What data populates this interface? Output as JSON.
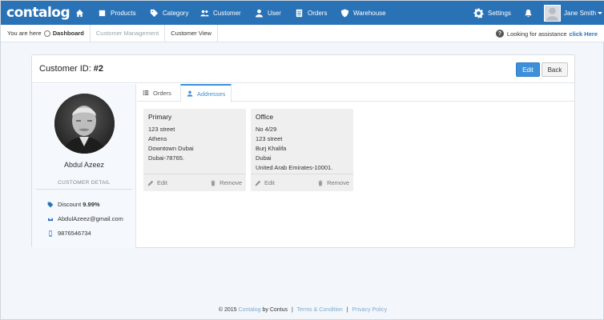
{
  "app": {
    "logo": "contalog"
  },
  "nav": {
    "items": [
      {
        "label": "",
        "icon": "home-icon"
      },
      {
        "label": "Products",
        "icon": "products-icon"
      },
      {
        "label": "Category",
        "icon": "tag-icon"
      },
      {
        "label": "Customer",
        "icon": "users-icon"
      },
      {
        "label": "User",
        "icon": "user-icon"
      },
      {
        "label": "Orders",
        "icon": "orders-icon"
      },
      {
        "label": "Warehouse",
        "icon": "shield-icon"
      }
    ],
    "settings": "Settings",
    "user": "Jane Smith"
  },
  "breadcrumb": {
    "prefix": "You are here",
    "items": [
      "Dashboard",
      "Customer Management",
      "Customer View"
    ],
    "assist_text": "Looking for assistance",
    "assist_link": "click Here"
  },
  "panel": {
    "title_label": "Customer ID:",
    "title_value": "#2",
    "edit": "Edit",
    "back": "Back"
  },
  "customer": {
    "name": "Abdul Azeez",
    "detail_heading": "CUSTOMER DETAIL",
    "discount_label": "Discount",
    "discount_value": "9.99%",
    "email": "AbdulAzeez@gmail.com",
    "phone": "9876546734"
  },
  "tabs": [
    "Orders",
    "Addresses"
  ],
  "addresses": [
    {
      "title": "Primary",
      "lines": [
        "123 street",
        "Athens",
        "Downtown Dubai",
        "Dubai-78765."
      ],
      "edit": "Edit",
      "remove": "Remove"
    },
    {
      "title": "Office",
      "lines": [
        "No 4/29",
        "123 street",
        "Burj Khalifa",
        "Dubai",
        "United Arab Emirates-10001."
      ],
      "edit": "Edit",
      "remove": "Remove"
    }
  ],
  "footer": {
    "copyright": "© 2015",
    "brand": "Contalog",
    "by": "by Contus",
    "terms": "Terms & Condition",
    "privacy": "Privacy Policy"
  },
  "colors": {
    "primary": "#2a72b6",
    "accent": "#3d8fd9",
    "background": "#f3f7fb"
  }
}
